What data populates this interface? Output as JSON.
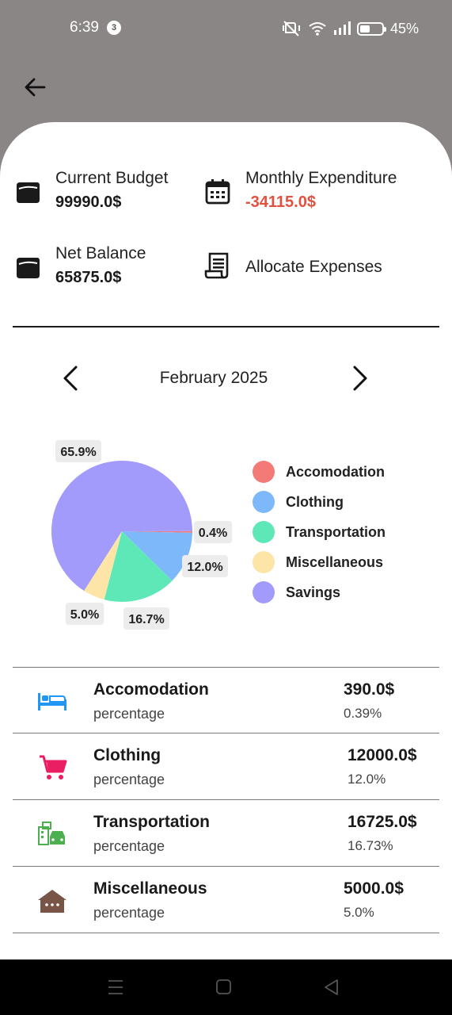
{
  "status_bar": {
    "time": "6:39",
    "notification_count": "3",
    "battery_percent": "45%",
    "battery_level": 0.45
  },
  "summary": {
    "current_budget_label": "Current Budget",
    "current_budget_value": "99990.0$",
    "monthly_expenditure_label": "Monthly Expenditure",
    "monthly_expenditure_value": "-34115.0$",
    "net_balance_label": "Net Balance",
    "net_balance_value": "65875.0$",
    "allocate_label": "Allocate Expenses"
  },
  "month_selector": {
    "label": "February 2025"
  },
  "chart_data": {
    "type": "pie",
    "slices": [
      {
        "name": "Accomodation",
        "value": 0.4,
        "label": "0.4%",
        "color": "#f47a78"
      },
      {
        "name": "Clothing",
        "value": 12.0,
        "label": "12.0%",
        "color": "#7db8fb"
      },
      {
        "name": "Transportation",
        "value": 16.7,
        "label": "16.7%",
        "color": "#5ee8b8"
      },
      {
        "name": "Miscellaneous",
        "value": 5.0,
        "label": "5.0%",
        "color": "#fde5a8"
      },
      {
        "name": "Savings",
        "value": 65.9,
        "label": "65.9%",
        "color": "#a29bfb"
      }
    ],
    "legend_position": "right"
  },
  "expenses": [
    {
      "name": "Accomodation",
      "sub": "percentage",
      "amount": "390.0$",
      "pct": "0.39%",
      "icon": "bed-icon",
      "color": "#2196f3"
    },
    {
      "name": "Clothing",
      "sub": "percentage",
      "amount": "12000.0$",
      "pct": "12.0%",
      "icon": "shopping-cart-icon",
      "color": "#e91e63"
    },
    {
      "name": "Transportation",
      "sub": "percentage",
      "amount": "16725.0$",
      "pct": "16.73%",
      "icon": "commute-icon",
      "color": "#4caf50"
    },
    {
      "name": "Miscellaneous",
      "sub": "percentage",
      "amount": "5000.0$",
      "pct": "5.0%",
      "icon": "house-icon",
      "color": "#795548"
    }
  ]
}
